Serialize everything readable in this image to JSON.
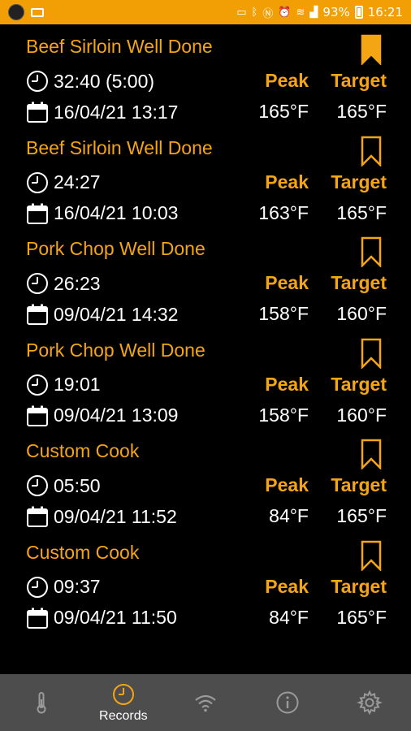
{
  "status_bar": {
    "battery": "93%",
    "time": "16:21",
    "accent": "#f29f05"
  },
  "records": [
    {
      "title": "Beef Sirloin Well Done",
      "duration": "32:40 (5:00)",
      "datetime": "16/04/21 13:17",
      "peak_label": "Peak",
      "target_label": "Target",
      "peak": "165°F",
      "target": "165°F",
      "bookmarked": true
    },
    {
      "title": "Beef Sirloin Well Done",
      "duration": "24:27",
      "datetime": "16/04/21 10:03",
      "peak_label": "Peak",
      "target_label": "Target",
      "peak": "163°F",
      "target": "165°F",
      "bookmarked": false
    },
    {
      "title": "Pork Chop Well Done",
      "duration": "26:23",
      "datetime": "09/04/21 14:32",
      "peak_label": "Peak",
      "target_label": "Target",
      "peak": "158°F",
      "target": "160°F",
      "bookmarked": false
    },
    {
      "title": "Pork Chop Well Done",
      "duration": "19:01",
      "datetime": "09/04/21 13:09",
      "peak_label": "Peak",
      "target_label": "Target",
      "peak": "158°F",
      "target": "160°F",
      "bookmarked": false
    },
    {
      "title": "Custom Cook",
      "duration": "05:50",
      "datetime": "09/04/21 11:52",
      "peak_label": "Peak",
      "target_label": "Target",
      "peak": "84°F",
      "target": "165°F",
      "bookmarked": false
    },
    {
      "title": "Custom Cook",
      "duration": "09:37",
      "datetime": "09/04/21 11:50",
      "peak_label": "Peak",
      "target_label": "Target",
      "peak": "84°F",
      "target": "165°F",
      "bookmarked": false
    }
  ],
  "nav": {
    "records_label": "Records",
    "active": "records",
    "active_color": "#f4a513",
    "icons": [
      "thermometer-icon",
      "clock-icon",
      "wifi-icon",
      "info-icon",
      "gear-icon"
    ]
  }
}
